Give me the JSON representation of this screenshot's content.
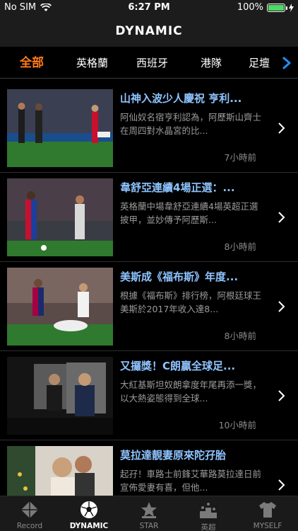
{
  "status": {
    "carrier": "No SIM",
    "time": "6:27 PM",
    "battery": "100%"
  },
  "nav": {
    "title": "DYNAMIC"
  },
  "tabs": [
    "全部",
    "英格蘭",
    "西班牙",
    "港隊",
    "足壇"
  ],
  "colors": {
    "accent": "#ff7a1a",
    "title": "#8ec4ff",
    "arrow": "#1e90ff"
  },
  "news": [
    {
      "title": "山神入波少人慶祝 亨利...",
      "summary": "阿仙奴名宿亨利認為，阿歷斯山齊士在周四對水晶宮的比...",
      "time": "7小時前"
    },
    {
      "title": "韋舒亞連續4場正選：...",
      "summary": "英格蘭中場韋舒亞連續4場英超正選披甲，並妙傳予阿歷斯...",
      "time": "8小時前"
    },
    {
      "title": "美斯成《福布斯》年度...",
      "summary": "根據《福布斯》排行榜，阿根廷球王美斯於2017年收入達8...",
      "time": "8小時前"
    },
    {
      "title": "又攞獎！C朗贏全球足...",
      "summary": "大紅基斯坦奴朗拿度年尾再添一獎，以大熱姿態得到全球...",
      "time": "10小時前"
    },
    {
      "title": "莫拉達靚妻原來陀孖胎",
      "summary": "起孖！車路士前鋒艾華路莫拉達日前宣佈愛妻有喜，但他...",
      "time": ""
    }
  ],
  "tabbar": [
    {
      "label": "Record",
      "icon": "record-icon"
    },
    {
      "label": "DYNAMIC",
      "icon": "soccer-ball-icon"
    },
    {
      "label": "STAR",
      "icon": "star-icon"
    },
    {
      "label": "英超",
      "icon": "podium-icon"
    },
    {
      "label": "MYSELF",
      "icon": "jersey-icon"
    }
  ]
}
